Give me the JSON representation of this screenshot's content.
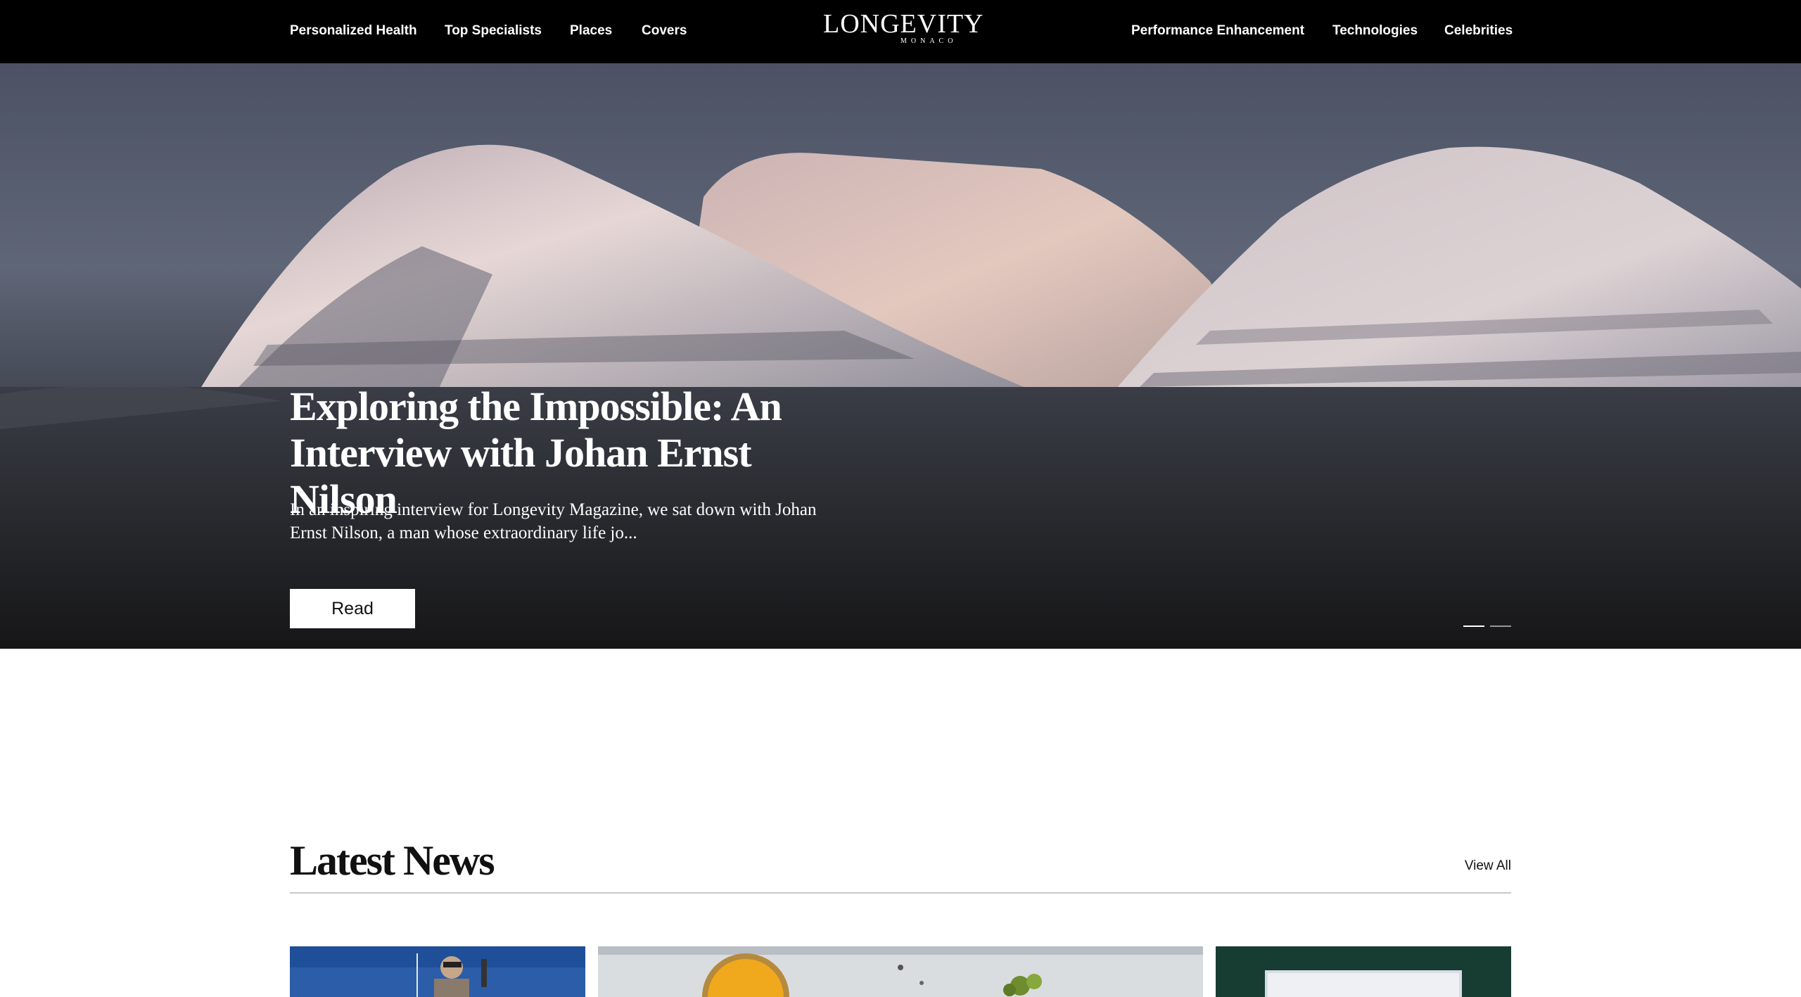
{
  "nav": {
    "left": [
      "Personalized Health",
      "Top Specialists",
      "Places",
      "Covers"
    ],
    "right": [
      "Performance Enhancement",
      "Technologies",
      "Celebrities"
    ],
    "logo": {
      "main": "LONGEVITY",
      "sub": "MONACO"
    }
  },
  "hero": {
    "title": "Exploring the Impossible: An Interview with Johan Ernst Nilson",
    "excerpt": "In an inspiring interview for Longevity Magazine, we sat down with Johan Ernst Nilson, a man whose extraordinary life jo...",
    "button": "Read",
    "slides": 2,
    "active_slide": 1
  },
  "latest_news": {
    "heading": "Latest News",
    "view_all": "View All"
  },
  "colors": {
    "nav_bg": "#000000",
    "text_light": "#ffffff",
    "text_dark": "#111111",
    "rule": "#c9c9c9"
  }
}
